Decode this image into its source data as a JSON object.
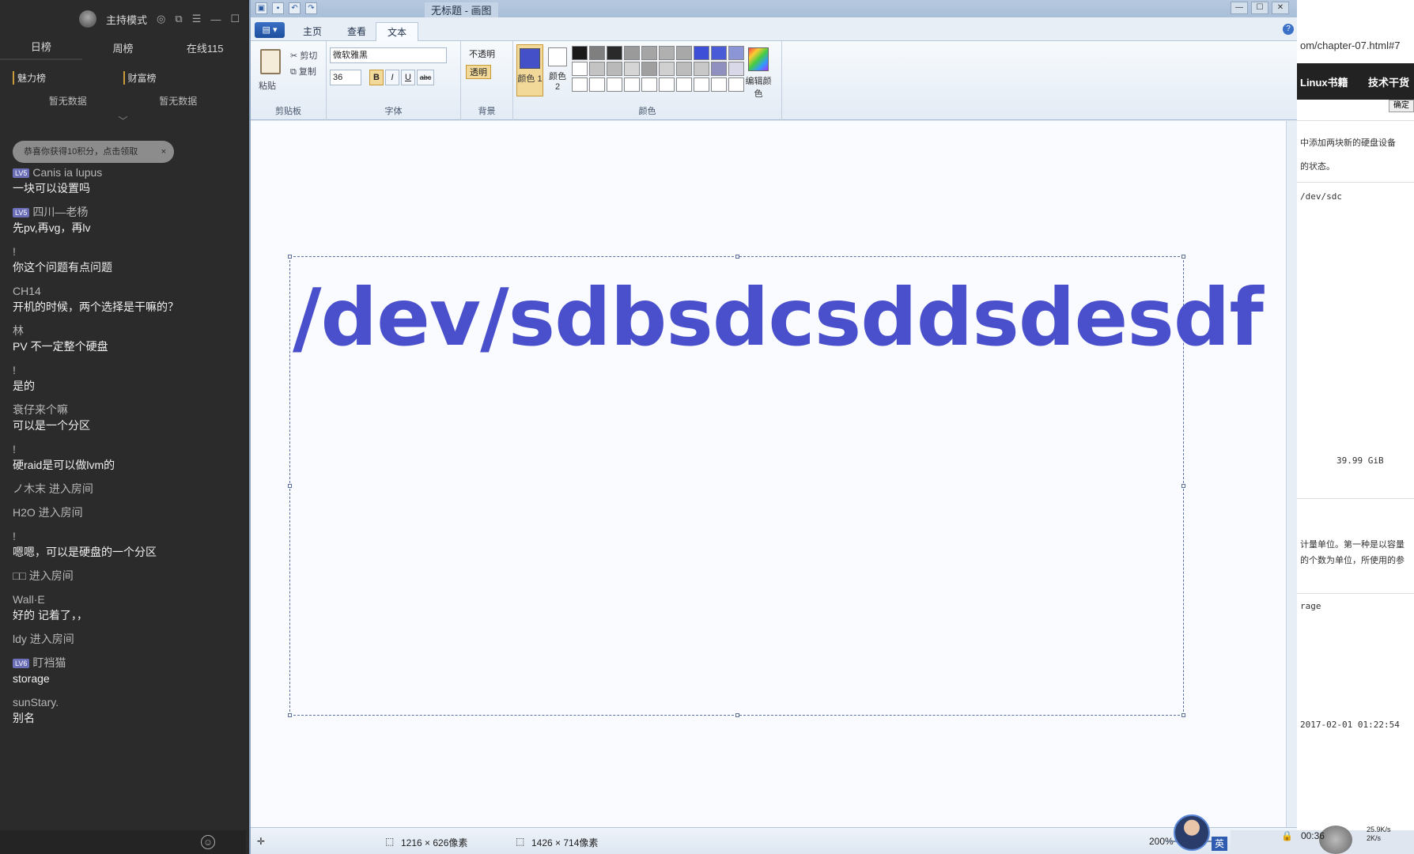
{
  "chat": {
    "mode_label": "主持模式",
    "tabs": [
      "日榜",
      "周榜",
      "在线115"
    ],
    "rank_left_title": "魅力榜",
    "rank_right_title": "财富榜",
    "rank_left_empty": "暂无数据",
    "rank_right_empty": "暂无数据",
    "notice": "恭喜你获得10积分，点击领取",
    "messages": [
      {
        "name": "Canis ia lupus",
        "level": "LV5",
        "text": "一块可以设置吗"
      },
      {
        "name": "四川—老杨",
        "level": "LV5",
        "text": "先pv,再vg，再lv"
      },
      {
        "name": "!",
        "level": "",
        "text": "你这个问题有点问题"
      },
      {
        "name": "CH14",
        "level": "",
        "text": "开机的时候，两个选择是干嘛的？"
      },
      {
        "name": "林",
        "level": "",
        "text": "PV 不一定整个硬盘"
      },
      {
        "name": "!",
        "level": "",
        "text": "是的"
      },
      {
        "name": "衰仔来个嘛",
        "level": "",
        "text": "可以是一个分区"
      },
      {
        "name": "!",
        "level": "",
        "text": "硬raid是可以做lvm的"
      },
      {
        "name": "",
        "level": "",
        "text": "ノ木末 进入房间",
        "system": true
      },
      {
        "name": "",
        "level": "",
        "text": "H2O 进入房间",
        "system": true
      },
      {
        "name": "!",
        "level": "",
        "text": "嗯嗯，可以是硬盘的一个分区"
      },
      {
        "name": "",
        "level": "",
        "text": "□□ 进入房间",
        "system": true
      },
      {
        "name": "Wall·E",
        "level": "",
        "text": "好的 记着了，，"
      },
      {
        "name": "",
        "level": "",
        "text": "ldy 进入房间",
        "system": true
      },
      {
        "name": "盯裆猫",
        "level": "LV6",
        "text": "storage"
      },
      {
        "name": "sunStary.",
        "level": "",
        "text": "别名"
      }
    ]
  },
  "paint": {
    "title": "无标题 - 画图",
    "file_button": "▤ ▾",
    "ribbon_tabs": [
      "主页",
      "查看",
      "文本"
    ],
    "clipboard": {
      "paste": "粘贴",
      "cut": "剪切",
      "copy": "复制",
      "label": "剪贴板"
    },
    "font": {
      "family": "微软雅黑",
      "size": "36",
      "label": "字体",
      "bold": "B",
      "italic": "I",
      "underline": "U",
      "strike": "abc"
    },
    "background": {
      "opaque": "不透明",
      "transparent": "透明",
      "label": "背景"
    },
    "colors": {
      "color1_label": "颜色 1",
      "color2_label": "颜色 2",
      "edit_label": "编辑颜色",
      "label": "颜色",
      "color1": "#4450c8",
      "palette": [
        "#1a1a1a",
        "#7f7f7f",
        "#2a2a2a",
        "#9a9a9a",
        "#a5a5a5",
        "#b0b0b0",
        "#a8a8a8",
        "#3d4fd6",
        "#4a5bd8",
        "#8c96d6",
        "#ffffff",
        "#c3c3c3",
        "#b9b9b9",
        "#d5d5d5",
        "#a0a0a0",
        "#d0d0d0",
        "#bcbcbc",
        "#c8c8c8",
        "#8f8fc0",
        "#d8d8e8",
        "#ffffff",
        "#ffffff",
        "#ffffff",
        "#ffffff",
        "#ffffff",
        "#ffffff",
        "#ffffff",
        "#ffffff",
        "#ffffff",
        "#ffffff"
      ]
    },
    "canvas_text": "/dev/sdbsdcsddsdesdf",
    "status": {
      "selection_size": "1216 × 626像素",
      "canvas_size": "1426 × 714像素",
      "zoom": "200%"
    }
  },
  "browser": {
    "url": "om/chapter-07.html#7",
    "nav": [
      "Linux书籍",
      "技术干货"
    ],
    "confirm": "确定",
    "lines": [
      "中添加两块新的硬盘设备",
      "的状态。",
      "/dev/sdc",
      "39.99 GiB",
      "计量单位。第一种是以容量",
      "的个数为单位，所使用的参",
      "rage",
      "2017-02-01 01:22:54"
    ]
  },
  "tray": {
    "ime": "英",
    "time": "00:36",
    "speed_up": "25.9K/s",
    "speed_down": "2K/s"
  }
}
